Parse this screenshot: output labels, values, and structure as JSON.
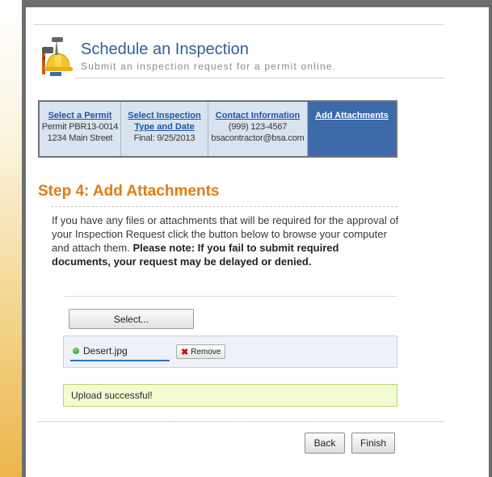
{
  "header": {
    "title": "Schedule an Inspection",
    "subtitle": "Submit an inspection request for a permit online."
  },
  "steps": [
    {
      "label": "Select a Permit",
      "lines": [
        "Permit PBR13-0014",
        "1234 Main Street"
      ]
    },
    {
      "label": "Select Inspection Type and Date",
      "label_lines": [
        "Select Inspection",
        "Type and Date"
      ],
      "lines": [
        "Final: 9/25/2013"
      ]
    },
    {
      "label": "Contact Information",
      "lines": [
        "(999) 123-4567",
        "bsacontractor@bsa.com"
      ]
    },
    {
      "label": "Add Attachments",
      "lines": []
    }
  ],
  "main": {
    "step_title": "Step 4: Add Attachments",
    "description": "If you have any files or attachments that will be required for the approval of your Inspection Request click the button below to browse your computer and attach them.",
    "note": "Please note: If you fail to submit required documents, your request may be delayed or denied."
  },
  "upload": {
    "select_label": "Select...",
    "file_name": "Desert.jpg",
    "remove_label": "Remove",
    "success_message": "Upload successful!"
  },
  "footer": {
    "back_label": "Back",
    "finish_label": "Finish"
  },
  "colors": {
    "accent": "#3d6aa8",
    "step_title": "#e27a16",
    "success_bg": "#f3fbd2"
  }
}
